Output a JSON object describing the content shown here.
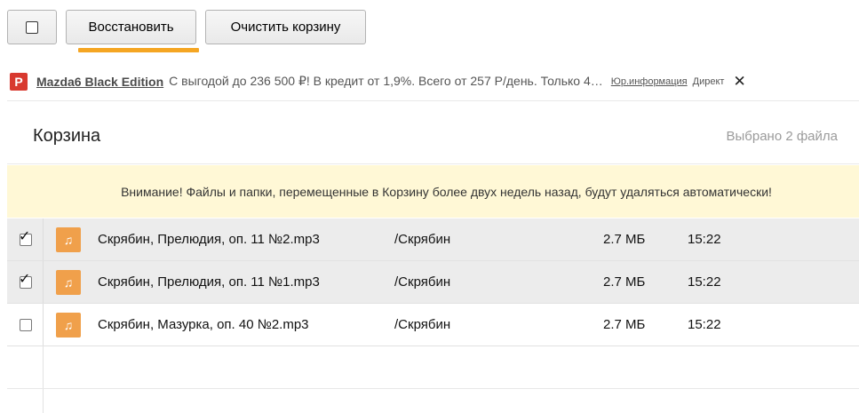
{
  "toolbar": {
    "select_all_icon": "checkbox-empty",
    "restore_label": "Восстановить",
    "clear_label": "Очистить корзину",
    "accent_color": "#f5a623"
  },
  "ad": {
    "logo_letter": "P",
    "title": "Mazda6 Black Edition",
    "text": "С выгодой до 236 500 ₽! В кредит от 1,9%. Всего от 257 Р/день. Только 4…",
    "legal_link": "Юр.информация",
    "direct_label": "Директ",
    "close_glyph": "✕"
  },
  "header": {
    "title": "Корзина",
    "selected_text": "Выбрано 2 файла"
  },
  "warning": {
    "text": "Внимание! Файлы и папки, перемещенные в Корзину более двух недель назад, будут удаляться автоматически!"
  },
  "files": [
    {
      "name": "Скрябин, Прелюдия, оп. 11 №2.mp3",
      "path": "/Скрябин",
      "size": "2.7 МБ",
      "time": "15:22",
      "checked": true,
      "icon": "music-note-icon"
    },
    {
      "name": "Скрябин, Прелюдия, оп. 11 №1.mp3",
      "path": "/Скрябин",
      "size": "2.7 МБ",
      "time": "15:22",
      "checked": true,
      "icon": "music-note-icon"
    },
    {
      "name": "Скрябин, Мазурка, оп. 40 №2.mp3",
      "path": "/Скрябин",
      "size": "2.7 МБ",
      "time": "15:22",
      "checked": false,
      "icon": "music-note-icon"
    }
  ]
}
